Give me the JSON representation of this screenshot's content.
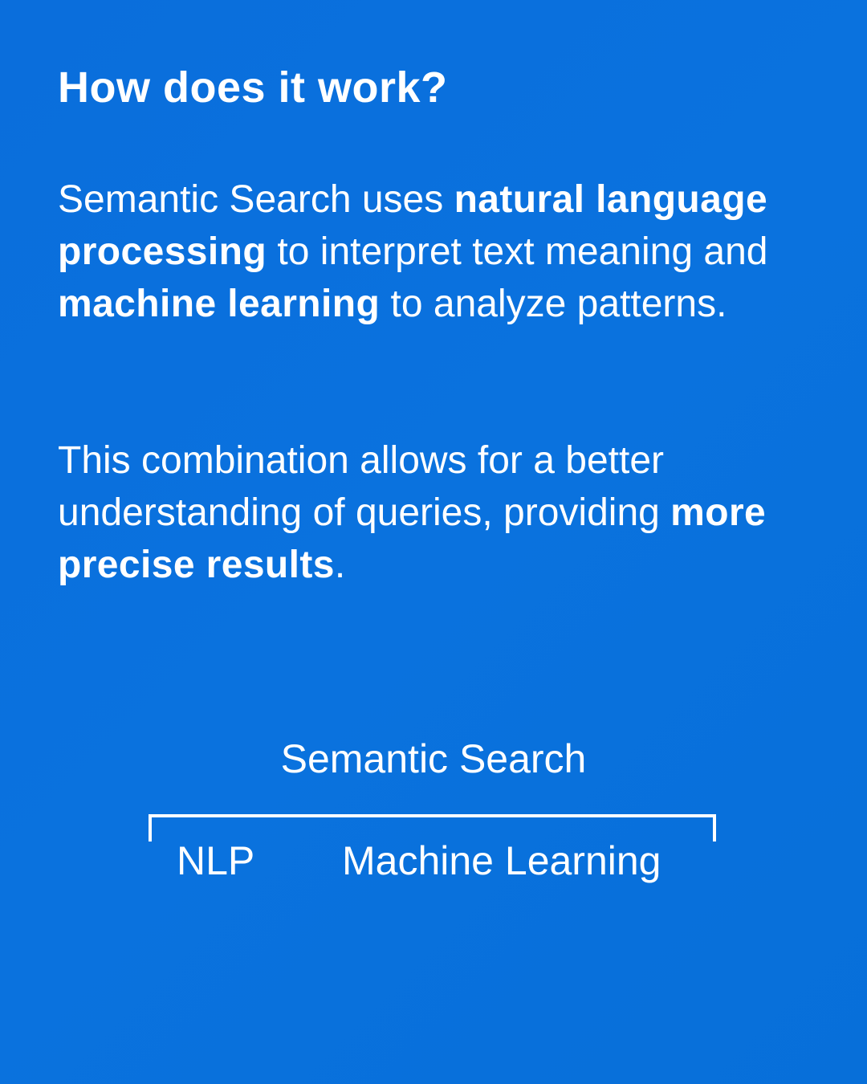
{
  "heading": "How does it work?",
  "paragraph1": {
    "t1": "Semantic Search uses ",
    "b1": "natural language processing",
    "t2": " to interpret text meaning and ",
    "b2": "machine learning",
    "t3": " to analyze patterns."
  },
  "paragraph2": {
    "t1": "This combination allows for a better understanding of queries, providing ",
    "b1": "more precise results",
    "t2": "."
  },
  "diagram": {
    "root": "Semantic Search",
    "children": [
      "NLP",
      "Machine Learning"
    ]
  },
  "colors": {
    "background": "#0a6edc",
    "text": "#ffffff"
  }
}
